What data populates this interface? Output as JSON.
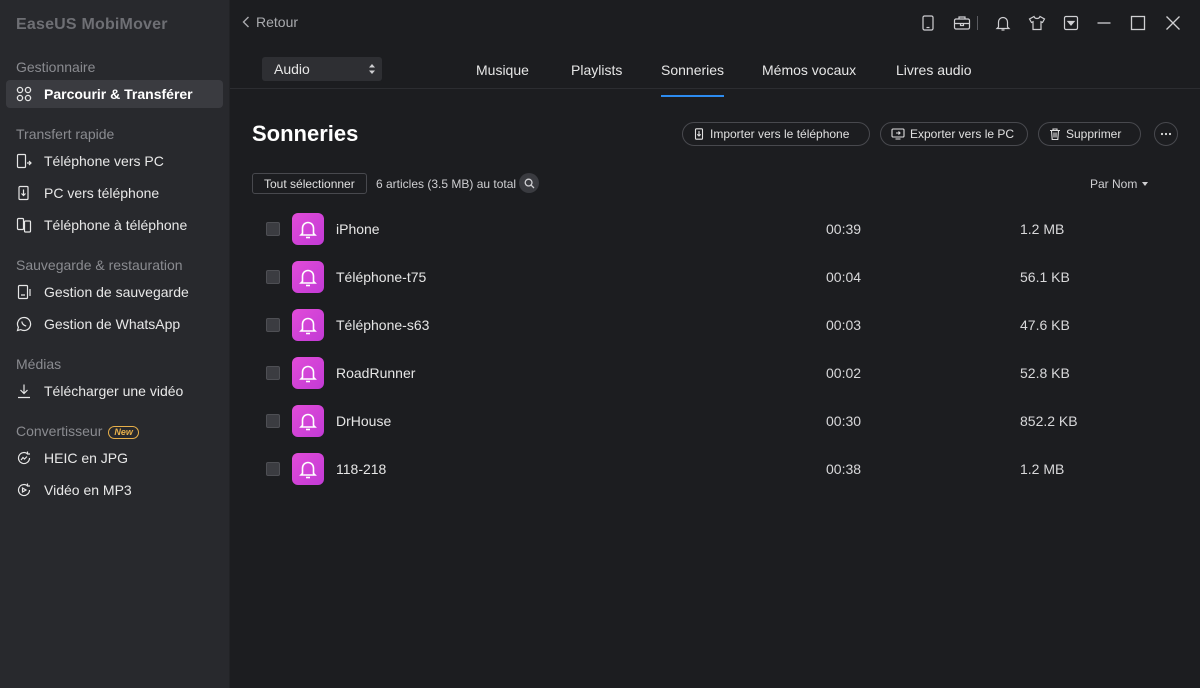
{
  "app": {
    "title": "EaseUS MobiMover"
  },
  "sidebar": {
    "sections": [
      {
        "title": "Gestionnaire",
        "new_badge": ""
      },
      {
        "title": "Transfert rapide",
        "new_badge": ""
      },
      {
        "title": "Sauvegarde & restauration",
        "new_badge": ""
      },
      {
        "title": "Médias",
        "new_badge": ""
      },
      {
        "title": "Convertisseur",
        "new_badge": "New"
      }
    ],
    "items": [
      {
        "label": "Parcourir & Transférer",
        "icon": "grid-icon",
        "active": true
      },
      {
        "label": "Téléphone vers PC",
        "icon": "phone-to-pc-icon"
      },
      {
        "label": "PC vers téléphone",
        "icon": "pc-to-phone-icon"
      },
      {
        "label": "Téléphone à téléphone",
        "icon": "phone-to-phone-icon"
      },
      {
        "label": "Gestion de sauvegarde",
        "icon": "backup-icon"
      },
      {
        "label": "Gestion de WhatsApp",
        "icon": "whatsapp-icon"
      },
      {
        "label": "Télécharger une vidéo",
        "icon": "download-icon"
      },
      {
        "label": "HEIC en JPG",
        "icon": "heic-convert-icon"
      },
      {
        "label": "Vidéo en MP3",
        "icon": "video-to-mp3-icon"
      }
    ]
  },
  "topbar": {
    "back_label": "Retour"
  },
  "category_select": {
    "value": "Audio"
  },
  "tabs": [
    {
      "label": "Musique"
    },
    {
      "label": "Playlists"
    },
    {
      "label": "Sonneries",
      "active": true
    },
    {
      "label": "Mémos vocaux"
    },
    {
      "label": "Livres audio"
    }
  ],
  "main": {
    "title": "Sonneries",
    "actions": {
      "import": "Importer vers le téléphone",
      "export": "Exporter vers le PC",
      "delete": "Supprimer"
    },
    "select_all": "Tout sélectionner",
    "count": "6 articles (3.5 MB) au total",
    "sort_label": "Par Nom",
    "items": [
      {
        "name": "iPhone",
        "duration": "00:39",
        "size": "1.2 MB"
      },
      {
        "name": "Téléphone-t75",
        "duration": "00:04",
        "size": "56.1 KB"
      },
      {
        "name": "Téléphone-s63",
        "duration": "00:03",
        "size": "47.6 KB"
      },
      {
        "name": "RoadRunner",
        "duration": "00:02",
        "size": "52.8 KB"
      },
      {
        "name": "DrHouse",
        "duration": "00:30",
        "size": "852.2 KB"
      },
      {
        "name": "118-218",
        "duration": "00:38",
        "size": "1.2 MB"
      }
    ]
  },
  "colors": {
    "accent": "#2d8cf0",
    "ringtone_icon": "#d843d7",
    "badge": "#e8b04a"
  }
}
